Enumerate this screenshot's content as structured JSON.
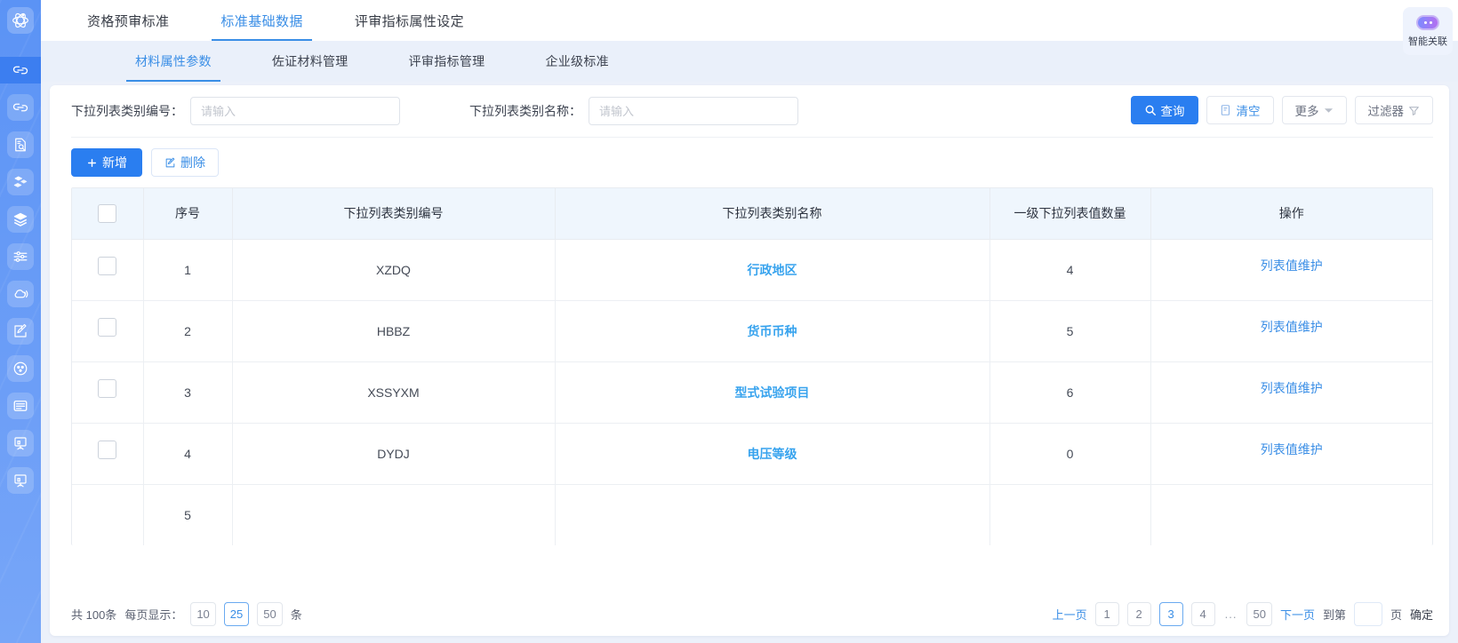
{
  "sidebar": {
    "logo_icon": "atom-logo-icon",
    "items": [
      {
        "icon": "link-nodes-icon",
        "name": "sidebar-item-link-nodes",
        "active": true
      },
      {
        "icon": "link-nodes-alt-icon",
        "name": "sidebar-item-link-nodes-alt",
        "active": false
      },
      {
        "icon": "document-search-icon",
        "name": "sidebar-item-document-search",
        "active": false
      },
      {
        "icon": "blocks-icon",
        "name": "sidebar-item-blocks",
        "active": false
      },
      {
        "icon": "layers-icon",
        "name": "sidebar-item-layers",
        "active": false
      },
      {
        "icon": "sliders-icon",
        "name": "sidebar-item-sliders",
        "active": false
      },
      {
        "icon": "cloud-signal-icon",
        "name": "sidebar-item-cloud-signal",
        "active": false
      },
      {
        "icon": "edit-square-icon",
        "name": "sidebar-item-edit-square",
        "active": false
      },
      {
        "icon": "dashboard-gauge-icon",
        "name": "sidebar-item-dashboard",
        "active": false
      },
      {
        "icon": "list-lines-icon",
        "name": "sidebar-item-list",
        "active": false
      },
      {
        "icon": "presentation-icon",
        "name": "sidebar-item-presentation-1",
        "active": false
      },
      {
        "icon": "presentation-icon",
        "name": "sidebar-item-presentation-2",
        "active": false
      }
    ],
    "expander_icon": "chevron-right-icon"
  },
  "header": {
    "tabs": [
      {
        "label": "资格预审标准",
        "active": false
      },
      {
        "label": "标准基础数据",
        "active": true
      },
      {
        "label": "评审指标属性设定",
        "active": false
      }
    ],
    "ai_button": {
      "label": "智能关联",
      "icon": "ai-chip-icon"
    }
  },
  "subtabs": [
    {
      "label": "材料属性参数",
      "active": true
    },
    {
      "label": "佐证材料管理",
      "active": false
    },
    {
      "label": "评审指标管理",
      "active": false
    },
    {
      "label": "企业级标准",
      "active": false
    }
  ],
  "filter": {
    "field1": {
      "label": "下拉列表类别编号：",
      "value": "",
      "placeholder": "请输入"
    },
    "field2": {
      "label": "下拉列表类别名称：",
      "value": "",
      "placeholder": "请输入"
    },
    "search_button": {
      "label": "查询",
      "icon": "search-icon"
    },
    "clear_button": {
      "label": "清空",
      "icon": "clear-form-icon"
    },
    "more_button": {
      "label": "更多",
      "icon": "chevron-down-icon"
    },
    "filter_button": {
      "label": "过滤器",
      "icon": "funnel-icon"
    }
  },
  "toolbar": {
    "add_button": {
      "label": "新增",
      "icon": "plus-icon"
    },
    "delete_button": {
      "label": "删除",
      "icon": "edit-delete-icon"
    }
  },
  "table": {
    "columns": [
      "",
      "序号",
      "下拉列表类别编号",
      "下拉列表类别名称",
      "一级下拉列表值数量",
      "操作"
    ],
    "rows": [
      {
        "index": "1",
        "code": "XZDQ",
        "name": "行政地区",
        "count": "4",
        "action": "列表值维护"
      },
      {
        "index": "2",
        "code": "HBBZ",
        "name": "货币币种",
        "count": "5",
        "action": "列表值维护"
      },
      {
        "index": "3",
        "code": "XSSYXM",
        "name": "型式试验项目",
        "count": "6",
        "action": "列表值维护"
      },
      {
        "index": "4",
        "code": "DYDJ",
        "name": "电压等级",
        "count": "0",
        "action": "列表值维护"
      },
      {
        "index": "5",
        "code": "",
        "name": "",
        "count": "",
        "action": ""
      }
    ]
  },
  "pagination": {
    "total_text": "共 100条",
    "page_size_label": "每页显示：",
    "page_sizes": [
      "10",
      "25",
      "50"
    ],
    "page_size_selected": "25",
    "unit": "条",
    "prev_label": "上一页",
    "pages": [
      "1",
      "2",
      "3",
      "4"
    ],
    "current_page": "3",
    "ellipsis": "...",
    "last_page": "50",
    "next_label": "下一页",
    "jump_label": "到第",
    "jump_value": "",
    "jump_unit": "页",
    "confirm_label": "确定"
  },
  "colors": {
    "accent": "#2a7ef0",
    "link": "#3a8ee6",
    "link_cyan": "#37a3ee",
    "sidebar": "#6c9ef7",
    "header_bg": "#eff6fd"
  }
}
